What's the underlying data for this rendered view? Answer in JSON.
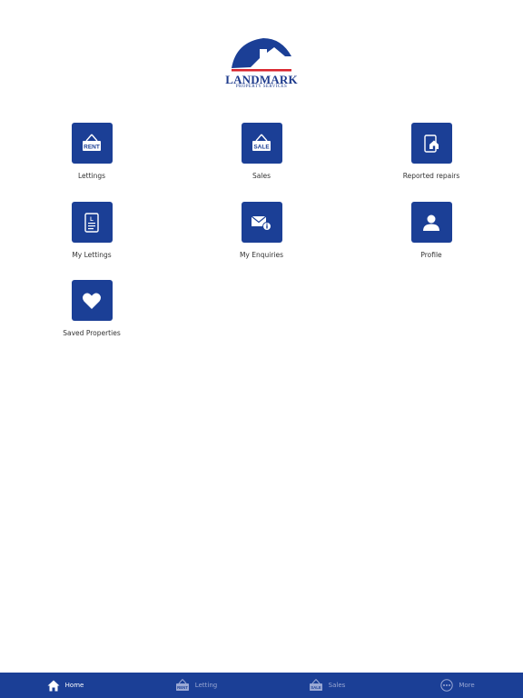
{
  "brand": {
    "name": "LANDMARK",
    "subtitle": "PROPERTY SERVICES",
    "primary_color": "#1b3f96",
    "accent_color": "#d9242c"
  },
  "tiles": [
    {
      "label": "Lettings",
      "icon": "rent-sign-icon",
      "sign_text": "RENT"
    },
    {
      "label": "Sales",
      "icon": "sale-sign-icon",
      "sign_text": "SALE"
    },
    {
      "label": "Reported repairs",
      "icon": "house-repair-icon"
    },
    {
      "label": "My Lettings",
      "icon": "document-icon",
      "doc_letter": "L"
    },
    {
      "label": "My Enquiries",
      "icon": "mail-info-icon"
    },
    {
      "label": "Profile",
      "icon": "person-icon"
    },
    {
      "label": "Saved Properties",
      "icon": "heart-icon"
    }
  ],
  "tabbar": [
    {
      "label": "Home",
      "icon": "home-icon",
      "active": true
    },
    {
      "label": "Letting",
      "icon": "rent-sign-icon",
      "sign_text": "RENT",
      "active": false
    },
    {
      "label": "Sales",
      "icon": "sale-sign-icon",
      "sign_text": "SALE",
      "active": false
    },
    {
      "label": "More",
      "icon": "more-dots-icon",
      "active": false
    }
  ]
}
